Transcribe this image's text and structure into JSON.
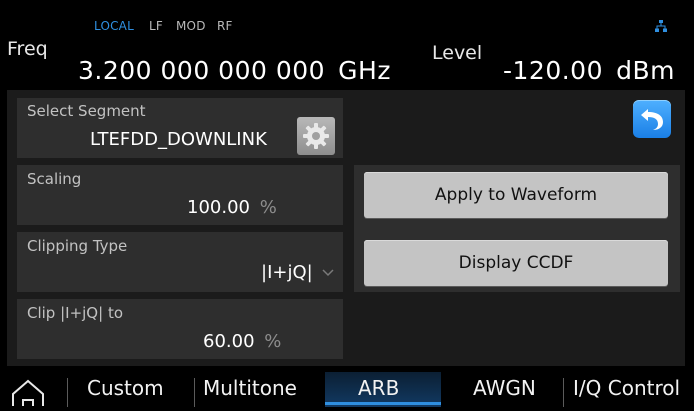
{
  "status": {
    "local": "LOCAL",
    "lf": "LF",
    "mod": "MOD",
    "rf": "RF"
  },
  "freq": {
    "label": "Freq",
    "value": "3.200 000 000 000",
    "unit": "GHz"
  },
  "level": {
    "label": "Level",
    "value": "-120.00",
    "unit": "dBm"
  },
  "segment": {
    "label": "Select Segment",
    "value": "LTEFDD_DOWNLINK"
  },
  "scaling": {
    "label": "Scaling",
    "value": "100.00",
    "unit": "%"
  },
  "clipping_type": {
    "label": "Clipping Type",
    "value": "|I+jQ|"
  },
  "clip_to": {
    "label": "Clip |I+jQ| to",
    "value": "60.00",
    "unit": "%"
  },
  "buttons": {
    "apply": "Apply to Waveform",
    "ccdf": "Display CCDF"
  },
  "tabs": [
    "Custom",
    "Multitone",
    "ARB",
    "AWGN",
    "I/Q Control"
  ],
  "active_tab": "ARB",
  "icons": {
    "network": "network-icon",
    "back": "back-arrow-icon",
    "gear": "gear-icon",
    "home": "home-icon",
    "dropdown": "chevron-down-icon"
  },
  "colors": {
    "accent": "#2f8fe0",
    "panel": "#1b1b1b",
    "field": "#2e2e2e",
    "button": "#c4c4c4"
  }
}
